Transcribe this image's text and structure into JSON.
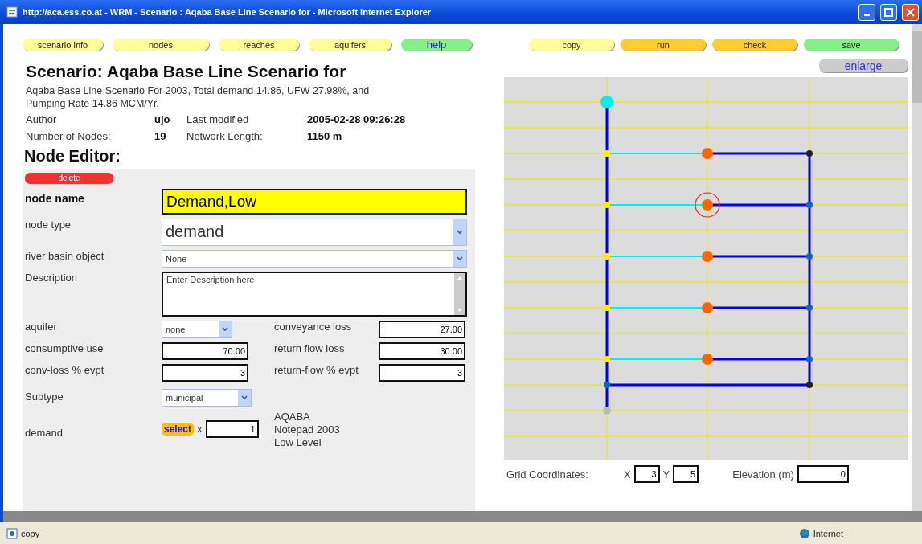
{
  "window": {
    "title": "http://aca.ess.co.at - WRM - Scenario : Aqaba Base Line Scenario for - Microsoft Internet Explorer"
  },
  "nav_buttons": [
    {
      "label": "scenario info",
      "color": "#ffff99"
    },
    {
      "label": "nodes",
      "color": "#ffff99"
    },
    {
      "label": "reaches",
      "color": "#ffff99"
    },
    {
      "label": "aquifers",
      "color": "#ffff99"
    },
    {
      "label": "help",
      "color": "#88ee88"
    }
  ],
  "action_buttons": [
    {
      "label": "copy",
      "color": "#ffff99"
    },
    {
      "label": "run",
      "color": "#ffcc33"
    },
    {
      "label": "check",
      "color": "#ffcc33"
    },
    {
      "label": "save",
      "color": "#88ee88"
    }
  ],
  "enlarge_button": "enlarge",
  "scenario": {
    "title": "Scenario: Aqaba Base Line Scenario for",
    "description": "Aqaba Base Line Scenario For 2003, Total demand 14.86, UFW 27.98%, and Pumping Rate 14.86 MCM/Yr.",
    "facts": [
      {
        "label": "Author",
        "value": "ujo",
        "label2": "Last modified",
        "value2": "2005-02-28 09:26:28"
      },
      {
        "label": "Number of Nodes:",
        "value": "19",
        "label2": "Network Length:",
        "value2": "1150 m"
      }
    ]
  },
  "node_editor": {
    "heading": "Node Editor:",
    "delete_button": "delete",
    "node_name": {
      "label": "node name",
      "value": "Demand,Low"
    },
    "node_type": {
      "label": "node type",
      "value": "demand"
    },
    "river_basin_object": {
      "label": "river basin object",
      "value": "None"
    },
    "description": {
      "label": "Description",
      "value": "Enter Description here"
    },
    "aquifer": {
      "label": "aquifer",
      "value": "none"
    },
    "conveyance_loss": {
      "label": "conveyance loss",
      "value": "27.00"
    },
    "consumptive_use": {
      "label": "consumptive use",
      "value": "70.00"
    },
    "return_flow_loss": {
      "label": "return flow loss",
      "value": "30.00"
    },
    "conv_loss_evpt": {
      "label": "conv-loss % evpt",
      "value": "3"
    },
    "return_flow_evpt": {
      "label": "return-flow % evpt",
      "value": "3"
    },
    "subtype": {
      "label": "Subtype",
      "value": "municipal"
    },
    "demand": {
      "label": "demand",
      "select_button": "select",
      "multiplier_label": "x",
      "multiplier_value": "1",
      "series": "AQABA Notepad 2003 Low Level"
    }
  },
  "grid_coordinates": {
    "label": "Grid Coordinates:",
    "x_label": "X",
    "x_value": "3",
    "y_label": "Y",
    "y_value": "5",
    "elevation_label": "Elevation (m)",
    "elevation_value": "0"
  },
  "status_bar": {
    "text": "copy",
    "zone": "Internet"
  }
}
